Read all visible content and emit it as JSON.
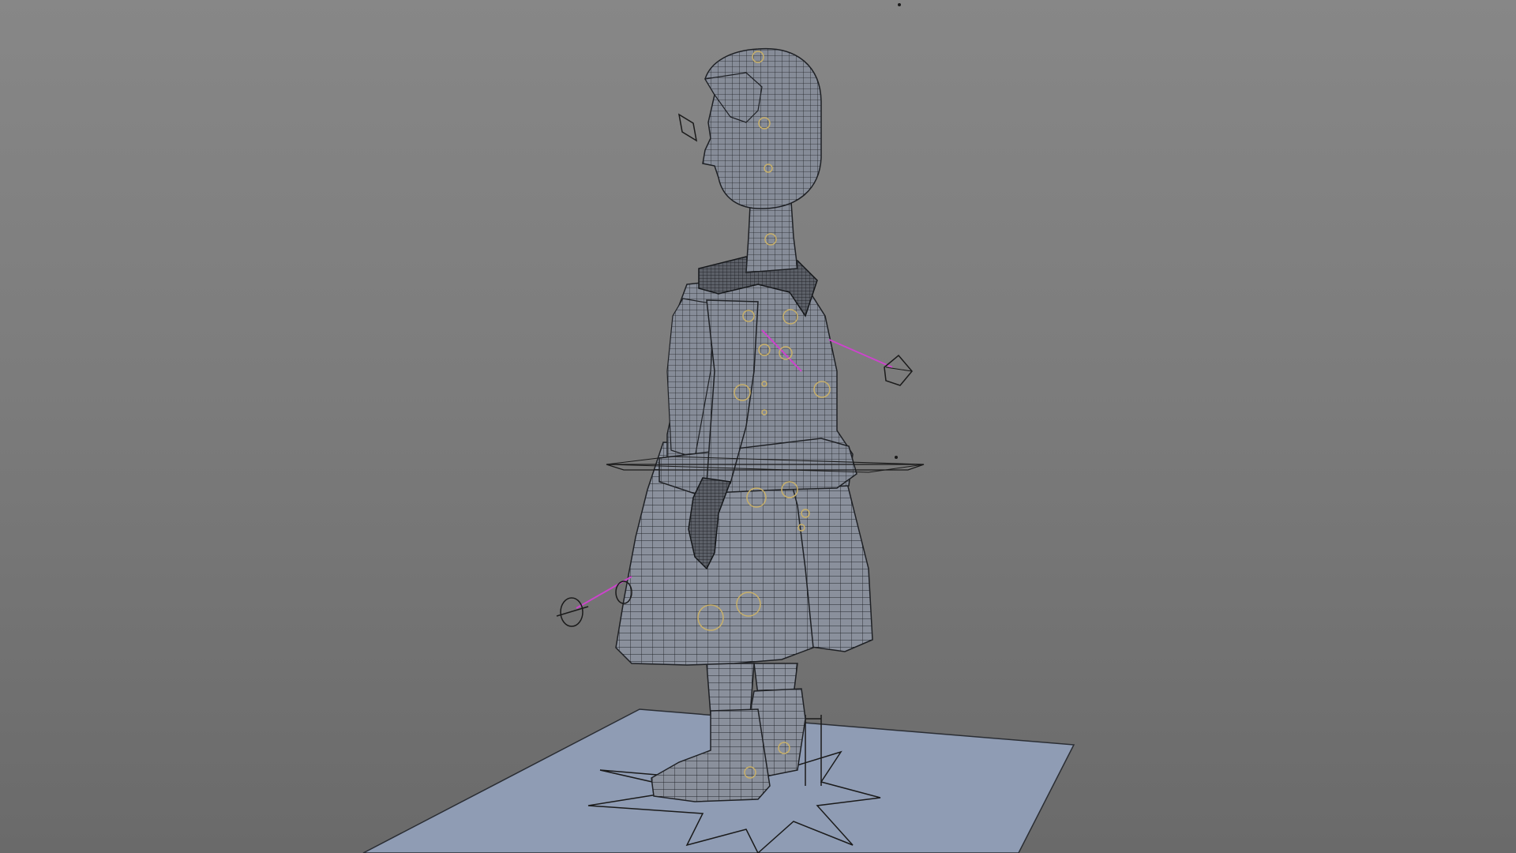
{
  "viewport": {
    "mode": "wireframe-on-shaded",
    "background_gradient": [
      "#878787",
      "#6a6a6a"
    ],
    "mesh_fill": "#8a909c",
    "wire_color": "#1e2024",
    "ground_plane_color": "#8f9cb4",
    "rig_control_color": "#c8b06a",
    "ik_line_color": "#cc44cc",
    "locator_color": "#1a1a1a"
  },
  "scene": {
    "subject": "character-mesh-with-rig",
    "ground_plane_icon": "ground-plane",
    "root_control_icon": "star-root-control"
  }
}
